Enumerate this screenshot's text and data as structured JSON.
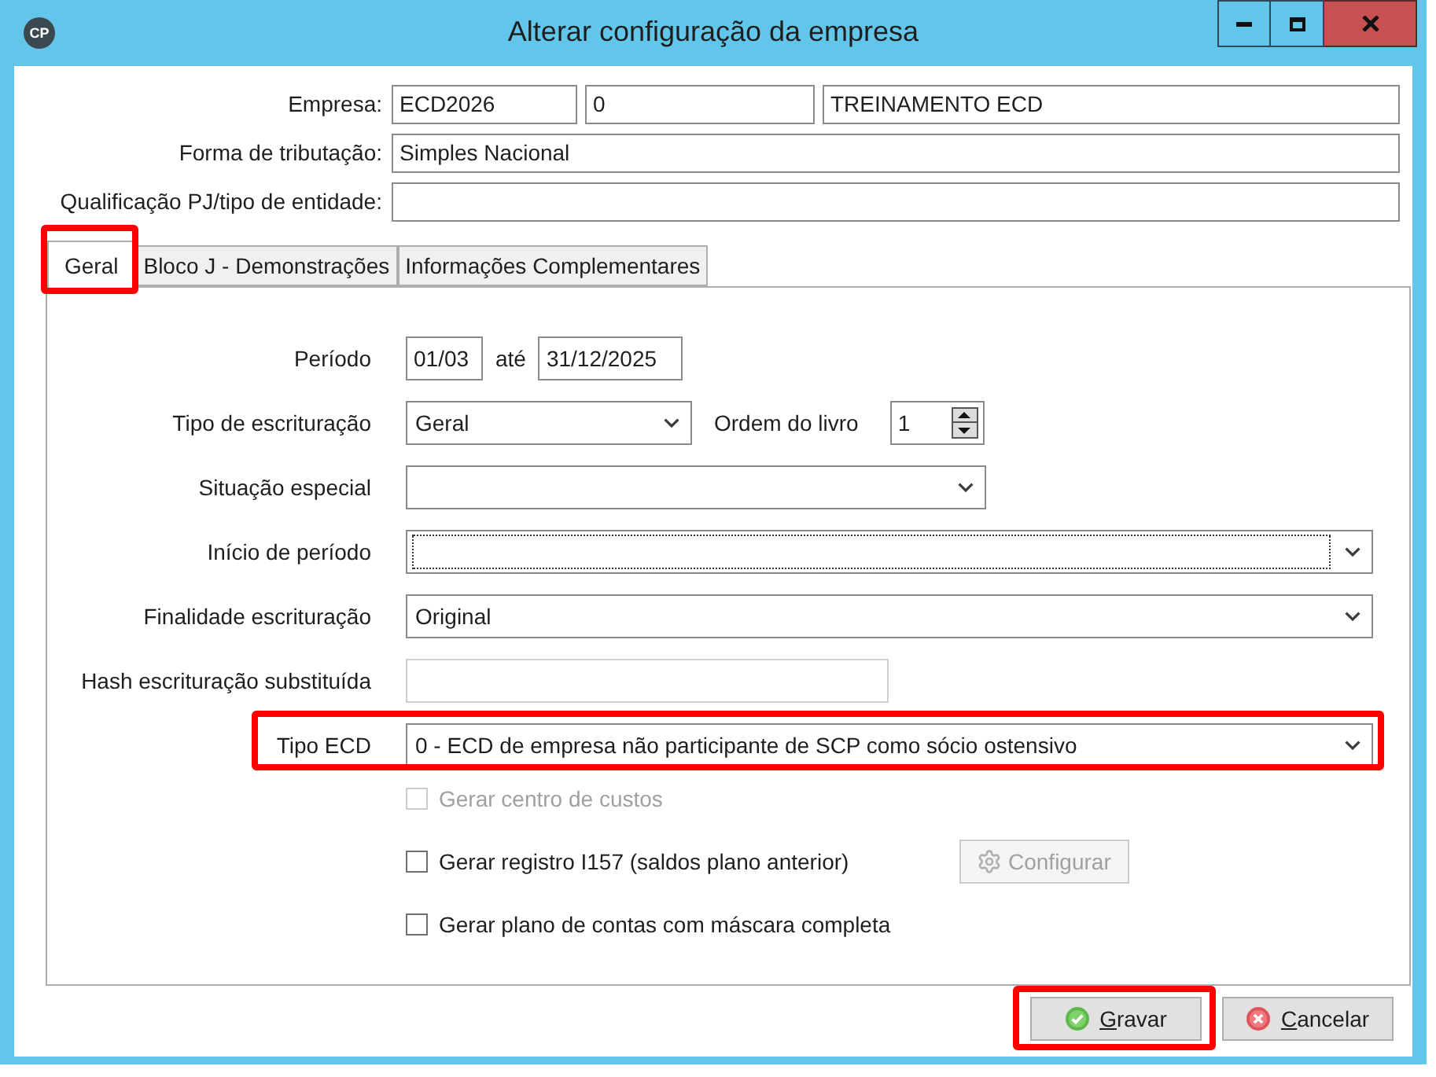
{
  "window": {
    "logo_text": "CP",
    "title": "Alterar configuração da empresa"
  },
  "header_fields": [
    {
      "label": "Empresa:",
      "values": [
        "ECD2026",
        "0",
        "TREINAMENTO ECD"
      ]
    },
    {
      "label": "Forma de tributação:",
      "values": [
        "Simples Nacional"
      ]
    },
    {
      "label": "Qualificação PJ/tipo de entidade:"
    }
  ],
  "tabs": [
    {
      "label": "Geral",
      "selected": true,
      "highlighted": true
    },
    {
      "label": "Bloco J - Demonstrações",
      "selected": false,
      "highlighted": false
    },
    {
      "label": "Informações Complementares",
      "selected": false,
      "highlighted": false
    }
  ],
  "form_rows": [
    {
      "kind": "period",
      "label": "Período",
      "from": "01/03",
      "separator": "até",
      "to": "31/12/2025",
      "focused": false,
      "disabled": false,
      "highlighted": false
    },
    {
      "kind": "select_spinner",
      "label": "Tipo de escrituração",
      "value": "Geral",
      "spinner_label": "Ordem do livro",
      "spinner_value": "1",
      "focused": false,
      "disabled": false,
      "highlighted": false
    },
    {
      "kind": "select",
      "label": "Situação especial",
      "focused": false,
      "disabled": false,
      "highlighted": false
    },
    {
      "kind": "select",
      "label": "Início de período",
      "focused": true,
      "disabled": false,
      "highlighted": false
    },
    {
      "kind": "select",
      "label": "Finalidade escrituração",
      "value": "Original",
      "focused": false,
      "disabled": false,
      "highlighted": false
    },
    {
      "kind": "text",
      "label": "Hash escrituração substituída",
      "focused": false,
      "disabled": true,
      "highlighted": false
    },
    {
      "kind": "select",
      "label": "Tipo ECD",
      "value": "0 - ECD de empresa não participante de SCP como sócio ostensivo",
      "focused": false,
      "disabled": false,
      "highlighted": true
    }
  ],
  "checkboxes": [
    {
      "label": "Gerar centro de custos",
      "checked": false,
      "disabled": true
    },
    {
      "label": "Gerar registro I157 (saldos plano anterior)",
      "checked": false,
      "disabled": false,
      "button": {
        "label": "Configurar",
        "disabled": true
      }
    },
    {
      "label": "Gerar plano de contas com máscara completa",
      "checked": false,
      "disabled": false
    }
  ],
  "buttons": [
    {
      "kind": "save",
      "label": "Gravar",
      "mnemonic": true,
      "highlighted": true
    },
    {
      "kind": "cancel",
      "label": "Cancelar",
      "mnemonic": true,
      "highlighted": false
    }
  ]
}
